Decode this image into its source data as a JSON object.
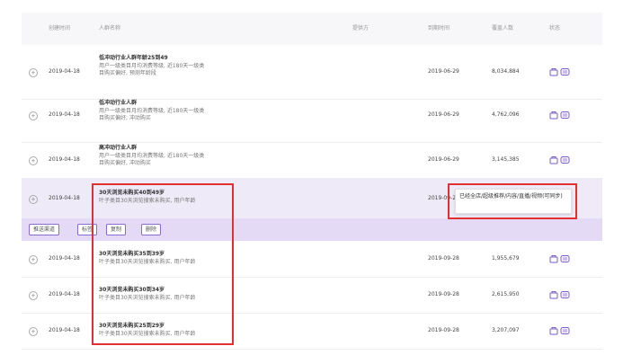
{
  "header": {
    "created": "创建时间",
    "name": "人群名称",
    "provider": "提供方",
    "expire": "到期时间",
    "coverage": "覆盖人数",
    "status": "状态"
  },
  "rows": [
    {
      "date": "2019-04-18",
      "title": "低冲动行业人群年龄25到49",
      "line1": "用户一级类目月均消费等级, 近180天一级类",
      "line2": "目购买偏好, 预测年龄段",
      "expire": "2019-06-29",
      "count": "8,034,884"
    },
    {
      "date": "2019-04-18",
      "title": "低冲动行业人群",
      "line1": "用户一级类目月均消费等级, 近180天一级类",
      "line2": "目购买偏好, 冲动购买",
      "expire": "2019-06-29",
      "count": "4,762,096"
    },
    {
      "date": "2019-04-18",
      "title": "高冲动行业人群",
      "line1": "用户一级类目月均消费等级, 近180天一级类",
      "line2": "目购买偏好, 冲动购买",
      "expire": "2019-06-29",
      "count": "3,145,385"
    },
    {
      "date": "2019-04-18",
      "title": "30天浏览未购买40到49岁",
      "line1": "叶子类目30天浏览搜索未购买, 用户年龄",
      "line2": "",
      "expire": "2019-09-28",
      "count": ""
    },
    {
      "date": "2019-04-18",
      "title": "30天浏览未购买35到39岁",
      "line1": "叶子类目30天浏览搜索未购买, 用户年龄",
      "line2": "",
      "expire": "2019-09-28",
      "count": "1,955,679"
    },
    {
      "date": "2019-04-18",
      "title": "30天浏览未购买30到34岁",
      "line1": "叶子类目30天浏览搜索未购买, 用户年龄",
      "line2": "",
      "expire": "2019-09-28",
      "count": "2,615,950"
    },
    {
      "date": "2019-04-18",
      "title": "30天浏览未购买25到29岁",
      "line1": "叶子类目30天浏览搜索未购买, 用户年龄",
      "line2": "",
      "expire": "2019-09-28",
      "count": "3,207,097"
    }
  ],
  "actions": {
    "push": "推送渠道",
    "tag": "标签",
    "copy": "复制",
    "delete": "删除"
  },
  "tooltip": {
    "text": "已经全店/超级推荐/内容/直播/视频(可同步)"
  },
  "colors": {
    "accent": "#8a6bd0",
    "highlight_row": "#efeaf8",
    "annotation": "#e03030"
  }
}
